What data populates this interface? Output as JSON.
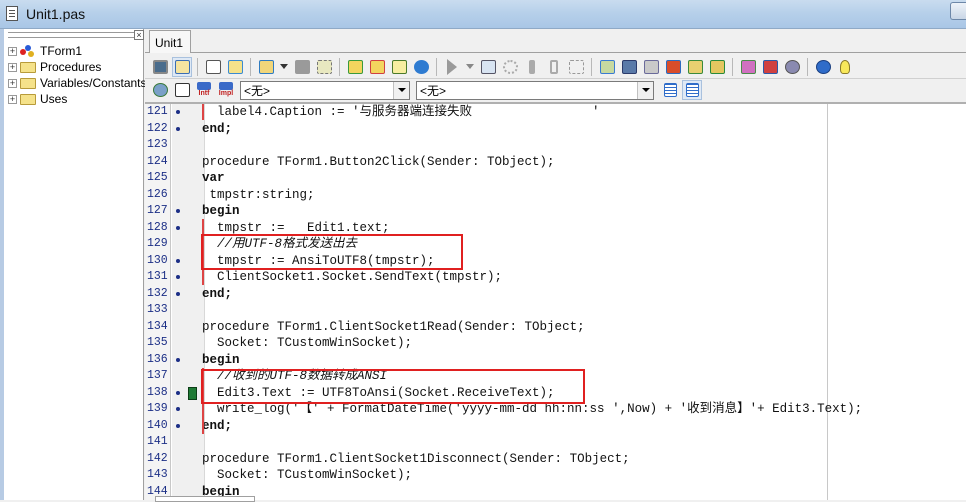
{
  "window": {
    "title": "Unit1.pas"
  },
  "explorer": {
    "items": [
      {
        "label": "TForm1",
        "icon": "form-class-icon"
      },
      {
        "label": "Procedures",
        "icon": "folder-icon"
      },
      {
        "label": "Variables/Constants",
        "icon": "folder-icon"
      },
      {
        "label": "Uses",
        "icon": "folder-icon"
      }
    ]
  },
  "tabs": [
    {
      "label": "Unit1",
      "active": true
    }
  ],
  "toolbar2": {
    "interface_label": "Intf",
    "implementation_label": "Impl",
    "class_combo_value": "<无>",
    "method_combo_value": "<无>"
  },
  "editor": {
    "lines": [
      {
        "num": "121",
        "dot": true,
        "text": "  label4.Caption := '与服务器端连接失败                '"
      },
      {
        "num": "122",
        "dot": true,
        "text": "end;"
      },
      {
        "num": "123",
        "dot": false,
        "text": ""
      },
      {
        "num": "124",
        "dot": false,
        "text": "procedure TForm1.Button2Click(Sender: TObject);"
      },
      {
        "num": "125",
        "dot": false,
        "text": "var"
      },
      {
        "num": "126",
        "dot": false,
        "text": " tmpstr:string;"
      },
      {
        "num": "127",
        "dot": true,
        "text": "begin"
      },
      {
        "num": "128",
        "dot": true,
        "text": "  tmpstr :=   Edit1.text;"
      },
      {
        "num": "129",
        "dot": false,
        "text": "  //用UTF-8格式发送出去"
      },
      {
        "num": "130",
        "dot": true,
        "text": "  tmpstr := AnsiToUTF8(tmpstr);"
      },
      {
        "num": "131",
        "dot": true,
        "text": "  ClientSocket1.Socket.SendText(tmpstr);"
      },
      {
        "num": "132",
        "dot": true,
        "text": "end;"
      },
      {
        "num": "133",
        "dot": false,
        "text": ""
      },
      {
        "num": "134",
        "dot": false,
        "text": "procedure TForm1.ClientSocket1Read(Sender: TObject;"
      },
      {
        "num": "135",
        "dot": false,
        "text": "  Socket: TCustomWinSocket);"
      },
      {
        "num": "136",
        "dot": true,
        "text": "begin"
      },
      {
        "num": "137",
        "dot": false,
        "text": "  //收到的UTF-8数据转成ANSI"
      },
      {
        "num": "138",
        "dot": true,
        "text": "  Edit3.Text := UTF8ToAnsi(Socket.ReceiveText);",
        "bookmark": true
      },
      {
        "num": "139",
        "dot": true,
        "text": "  write_log('【' + FormatDateTime('yyyy-mm-dd hh:nn:ss ',Now) + '收到消息】'+ Edit3.Text);"
      },
      {
        "num": "140",
        "dot": true,
        "text": "end;"
      },
      {
        "num": "141",
        "dot": false,
        "text": ""
      },
      {
        "num": "142",
        "dot": false,
        "text": "procedure TForm1.ClientSocket1Disconnect(Sender: TObject;"
      },
      {
        "num": "143",
        "dot": false,
        "text": "  Socket: TCustomWinSocket);"
      },
      {
        "num": "144",
        "dot": false,
        "text": "begin"
      }
    ]
  },
  "colors": {
    "keyword": "#b01515",
    "comment": "#2233aa",
    "line_number": "#1c2f86",
    "annotation_box": "#e02020"
  }
}
